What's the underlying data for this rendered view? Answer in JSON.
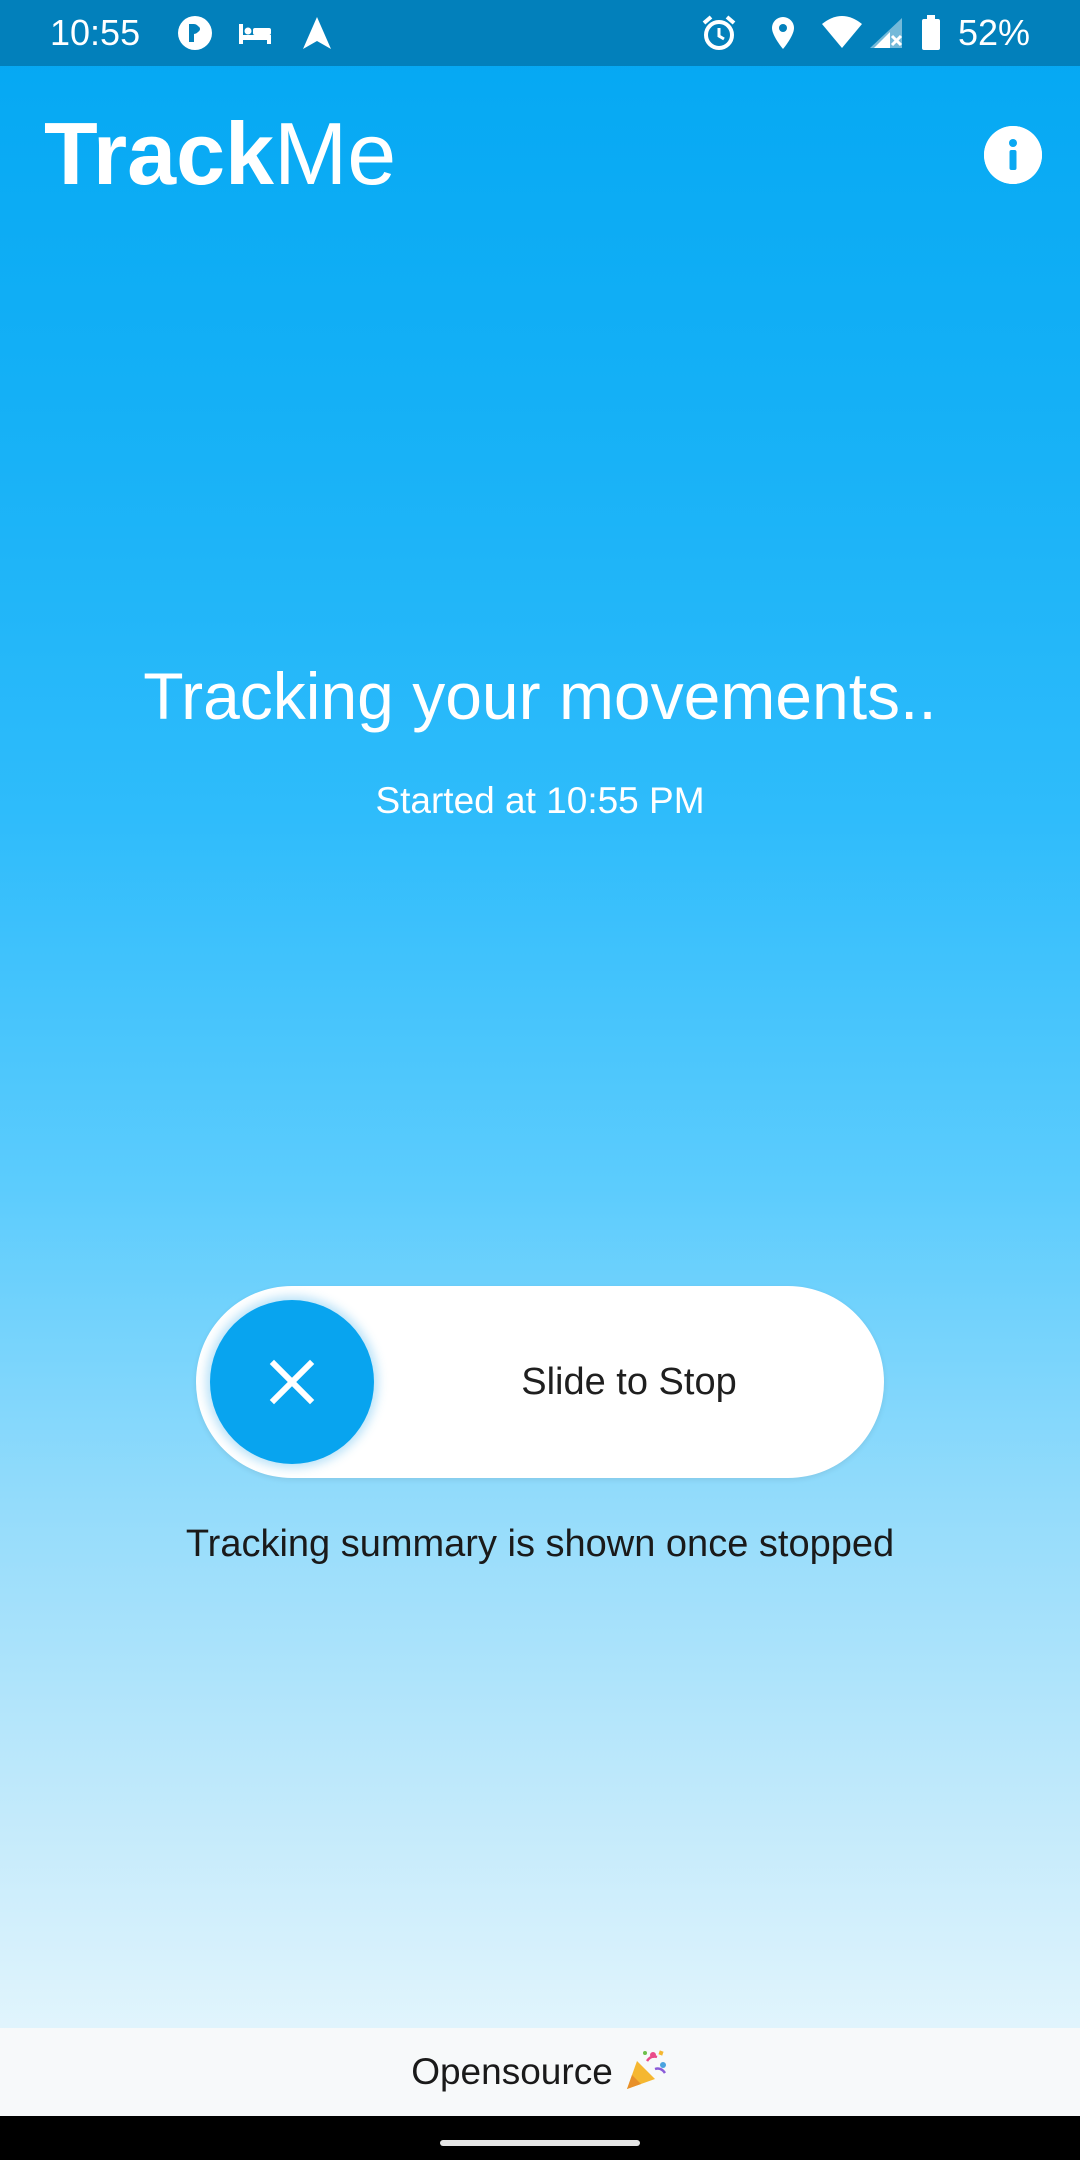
{
  "status_bar": {
    "time": "10:55",
    "battery_percent": "52%",
    "left_icons": [
      "circle-app-icon",
      "bed-icon",
      "navigation-arrow-icon"
    ],
    "right_icons": [
      "alarm-icon",
      "location-pin-icon",
      "wifi-icon",
      "signal-no-service-icon",
      "battery-icon"
    ]
  },
  "app_bar": {
    "title_bold": "Track",
    "title_light": "Me",
    "info_icon": "info-icon"
  },
  "main": {
    "headline": "Tracking your movements..",
    "started_text": "Started at 10:55 PM"
  },
  "slider": {
    "label": "Slide to Stop",
    "knob_icon": "close-icon",
    "position": 0
  },
  "summary_note": "Tracking summary is shown once stopped",
  "footer": {
    "text": "Opensource",
    "emoji_icon": "party-popper-icon"
  },
  "colors": {
    "status_bar": "#0280bb",
    "gradient_top": "#03a7f2",
    "gradient_bottom": "#f3fbfe",
    "knob": "#08a4ef",
    "footer_bg": "#f7f9fa"
  }
}
